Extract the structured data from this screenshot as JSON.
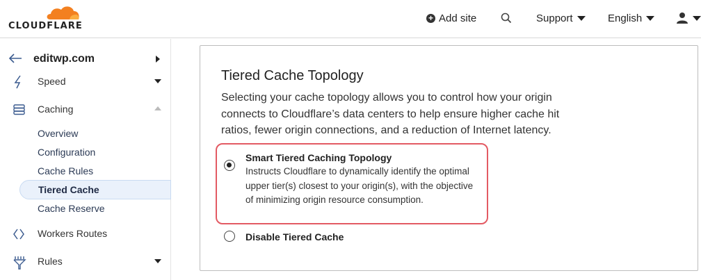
{
  "header": {
    "brand": "CLOUDFLARE",
    "add_site": "Add site",
    "support": "Support",
    "language": "English"
  },
  "sidebar": {
    "site": "editwp.com",
    "items": [
      {
        "label": "Speed"
      },
      {
        "label": "Caching"
      },
      {
        "label": "Workers Routes"
      },
      {
        "label": "Rules"
      }
    ],
    "caching_sub": [
      {
        "label": "Overview"
      },
      {
        "label": "Configuration"
      },
      {
        "label": "Cache Rules"
      },
      {
        "label": "Tiered Cache"
      },
      {
        "label": "Cache Reserve"
      }
    ]
  },
  "card": {
    "title": "Tiered Cache Topology",
    "description": "Selecting your cache topology allows you to control how your origin connects to Cloudflare’s data centers to help ensure higher cache hit ratios, fewer origin connections, and a reduction of Internet latency.",
    "options": [
      {
        "title": "Smart Tiered Caching Topology",
        "description": "Instructs Cloudflare to dynamically identify the optimal upper tier(s) closest to your origin(s), with the objective of minimizing origin resource consumption.",
        "selected": true
      },
      {
        "title": "Disable Tiered Cache",
        "selected": false
      }
    ]
  },
  "colors": {
    "brand_orange": "#f38020",
    "highlight_red": "#e35a63",
    "active_bg": "#eaf1fb"
  }
}
